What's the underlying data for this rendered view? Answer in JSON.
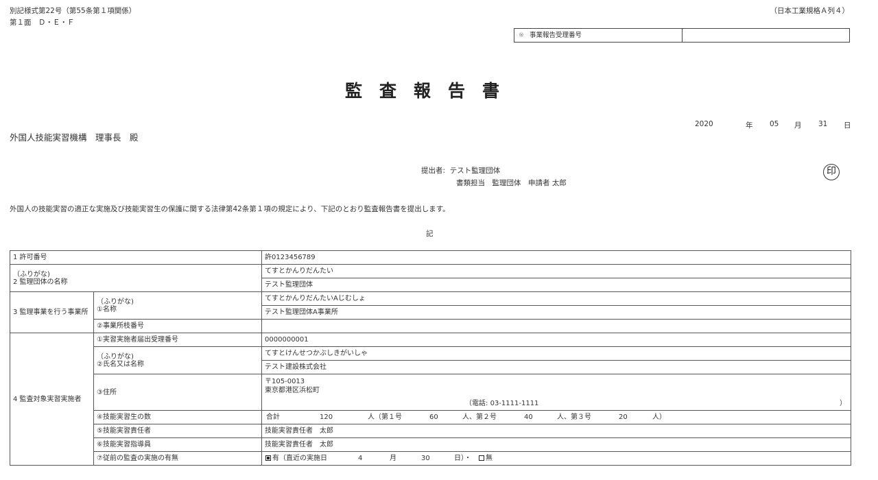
{
  "header": {
    "form_id": "別記様式第22号（第55条第１項関係）",
    "page": "第１面　Ｄ・Ｅ・Ｆ",
    "paper_size": "（日本工業規格Ａ列４）",
    "reception_mark": "※",
    "reception_label": "事業報告受理番号",
    "reception_value": ""
  },
  "title": "監査報告書",
  "date": {
    "year": "2020",
    "year_unit": "年",
    "month": "05",
    "month_unit": "月",
    "day": "31",
    "day_unit": "日"
  },
  "addressee": "外国人技能実習機構　理事長　殿",
  "submitter": {
    "label": "提出者:",
    "org": "テスト監理団体",
    "line2": "書類担当　監理団体　申請者 太郎",
    "seal": "印"
  },
  "statement": "外国人の技能実習の適正な実施及び技能実習生の保護に関する法律第42条第１項の規定により、下記のとおり監査報告書を提出します。",
  "ki": "記",
  "table": {
    "r1": {
      "label": "1 許可番号",
      "value": "許0123456789"
    },
    "r2": {
      "furigana_label": "（ふりがな)",
      "label": "2 監理団体の名称",
      "furigana": "てすとかんりだんたい",
      "value": "テスト監理団体"
    },
    "r3": {
      "label": "3 監理事業を行う事業所",
      "name_furigana_label": "（ふりがな)",
      "name_label": "①名称",
      "name_furigana": "てすとかんりだんたいAじむしょ",
      "name_value": "テスト監理団体A事業所",
      "office_no_label": "②事業所枝番号",
      "office_no_value": ""
    },
    "r4": {
      "label": "4 監査対象実習実施者",
      "notif_no_label": "①実習実施者届出受理番号",
      "notif_no_value": "0000000001",
      "name_furigana_label": "（ふりがな)",
      "name_label": "②氏名又は名称",
      "name_furigana": "てすとけんせつかぶしきがいしゃ",
      "name_value": "テスト建設株式会社",
      "address_label": "③住所",
      "postal": "〒105-0013",
      "address": "東京都港区浜松町",
      "phone_prefix": "（電話:",
      "phone": "03-1111-1111",
      "phone_close": "）",
      "trainees_label": "④技能実習生の数",
      "trainees": {
        "total_label": "合計",
        "total": "120",
        "unit1": "人（第１号",
        "no1": "60",
        "unit2": "人、第２号",
        "no2": "40",
        "unit3": "人、第３号",
        "no3": "20",
        "unit4": "人）"
      },
      "supervisor_label": "⑤技能実習責任者",
      "supervisor_value": "技能実習責任者　太郎",
      "instructor_label": "⑥技能実習指導員",
      "instructor_value": "技能実習責任者　太郎",
      "prev_audit_label": "⑦従前の監査の実施の有無",
      "prev_audit": {
        "checked_yes": true,
        "yes_label": "有（直近の実施日",
        "month": "4",
        "month_unit": "月",
        "day": "30",
        "day_unit": "日）・",
        "checked_no": false,
        "no_label": "無"
      }
    }
  }
}
